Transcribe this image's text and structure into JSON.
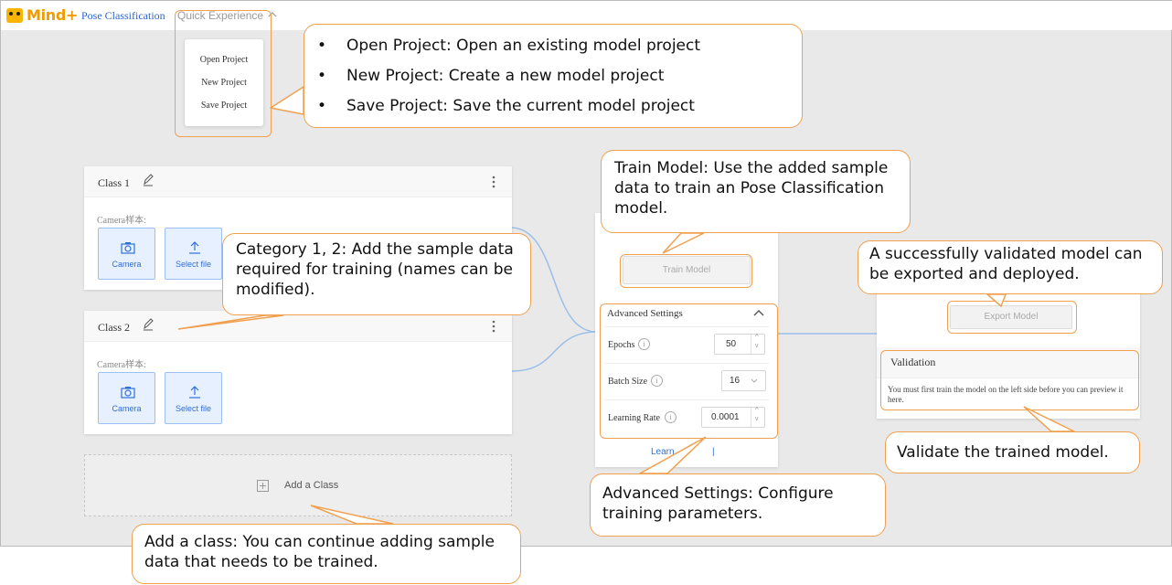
{
  "app": {
    "logo_text": "Mind+",
    "nav_pose": "Pose Classification",
    "nav_quick": "Quick Experience",
    "brand_color": "#f29b00",
    "accent_color": "#2f6fd6"
  },
  "dropdown": {
    "items": [
      "Open Project",
      "New Project",
      "Save Project"
    ]
  },
  "classes": [
    {
      "title": "Class 1",
      "sample_label": "Camera样本:",
      "camera_label": "Camera",
      "file_label": "Select file"
    },
    {
      "title": "Class 2",
      "sample_label": "Camera样本:",
      "camera_label": "Camera",
      "file_label": "Select file"
    }
  ],
  "add_class": {
    "label": "Add a Class"
  },
  "training": {
    "train_button": "Train Model",
    "advanced_title": "Advanced Settings",
    "epochs_label": "Epochs",
    "epochs_value": "50",
    "batch_label": "Batch Size",
    "batch_value": "16",
    "lr_label": "Learning Rate",
    "lr_value": "0.0001",
    "learn_more_left": "Learn",
    "learn_more_right": "|"
  },
  "export": {
    "export_button": "Export Model",
    "validation_title": "Validation",
    "validation_text": "You must first train the model on the left side before you can preview it here."
  },
  "callouts": {
    "project_bullets": [
      "Open Project: Open an existing model project",
      "New Project: Create a new model project",
      "Save Project: Save the current model project"
    ],
    "train_model": "Train Model: Use the added sample data to train an Pose Classification model.",
    "export_model": "A successfully validated model can be exported and deployed.",
    "category": "Category 1, 2: Add the sample data required for training (names can be modified).",
    "validate": "Validate the trained model.",
    "advanced": "Advanced Settings: Configure training parameters.",
    "add_class": "Add a class: You can continue adding sample data that needs to be trained."
  }
}
